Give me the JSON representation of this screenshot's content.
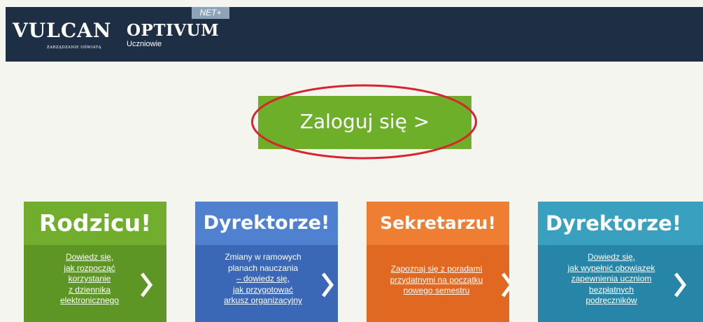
{
  "header": {
    "brand": "VULCAN",
    "brand_tagline": "ZARZĄDZANIE OŚWIATĄ",
    "product": "OPTIVUM",
    "product_badge": "NET+",
    "module": "Uczniowie"
  },
  "login": {
    "label": "Zaloguj się >"
  },
  "cards": [
    {
      "title": "Rodzicu!",
      "lines": [
        "Dowiedz się,",
        "jak rozpocząć",
        "korzystanie",
        "z dziennika",
        "elektronicznego"
      ],
      "color": "#72ae2e"
    },
    {
      "title": "Dyrektorze!",
      "plain_lines": [
        "Zmiany w ramowych",
        "planach nauczania"
      ],
      "lines": [
        "– dowiedz się,",
        "jak przygotować",
        "arkusz organizacyjny"
      ],
      "color": "#4f81d0"
    },
    {
      "title": "Sekretarzu!",
      "lines": [
        "Zapoznaj się z poradami",
        "przydatnymi na początku",
        "nowego semestru"
      ],
      "color": "#ef7e33"
    },
    {
      "title": "Dyrektorze!",
      "lines": [
        "Dowiedz się,",
        "jak wypełnić obowiązek",
        "zapewnienia uczniom",
        "bezpłatnych",
        "podręczników"
      ],
      "color": "#3aa0c0"
    }
  ],
  "icons": {
    "card_arrow": "chevron-right-icon",
    "highlight": "red-ellipse"
  }
}
